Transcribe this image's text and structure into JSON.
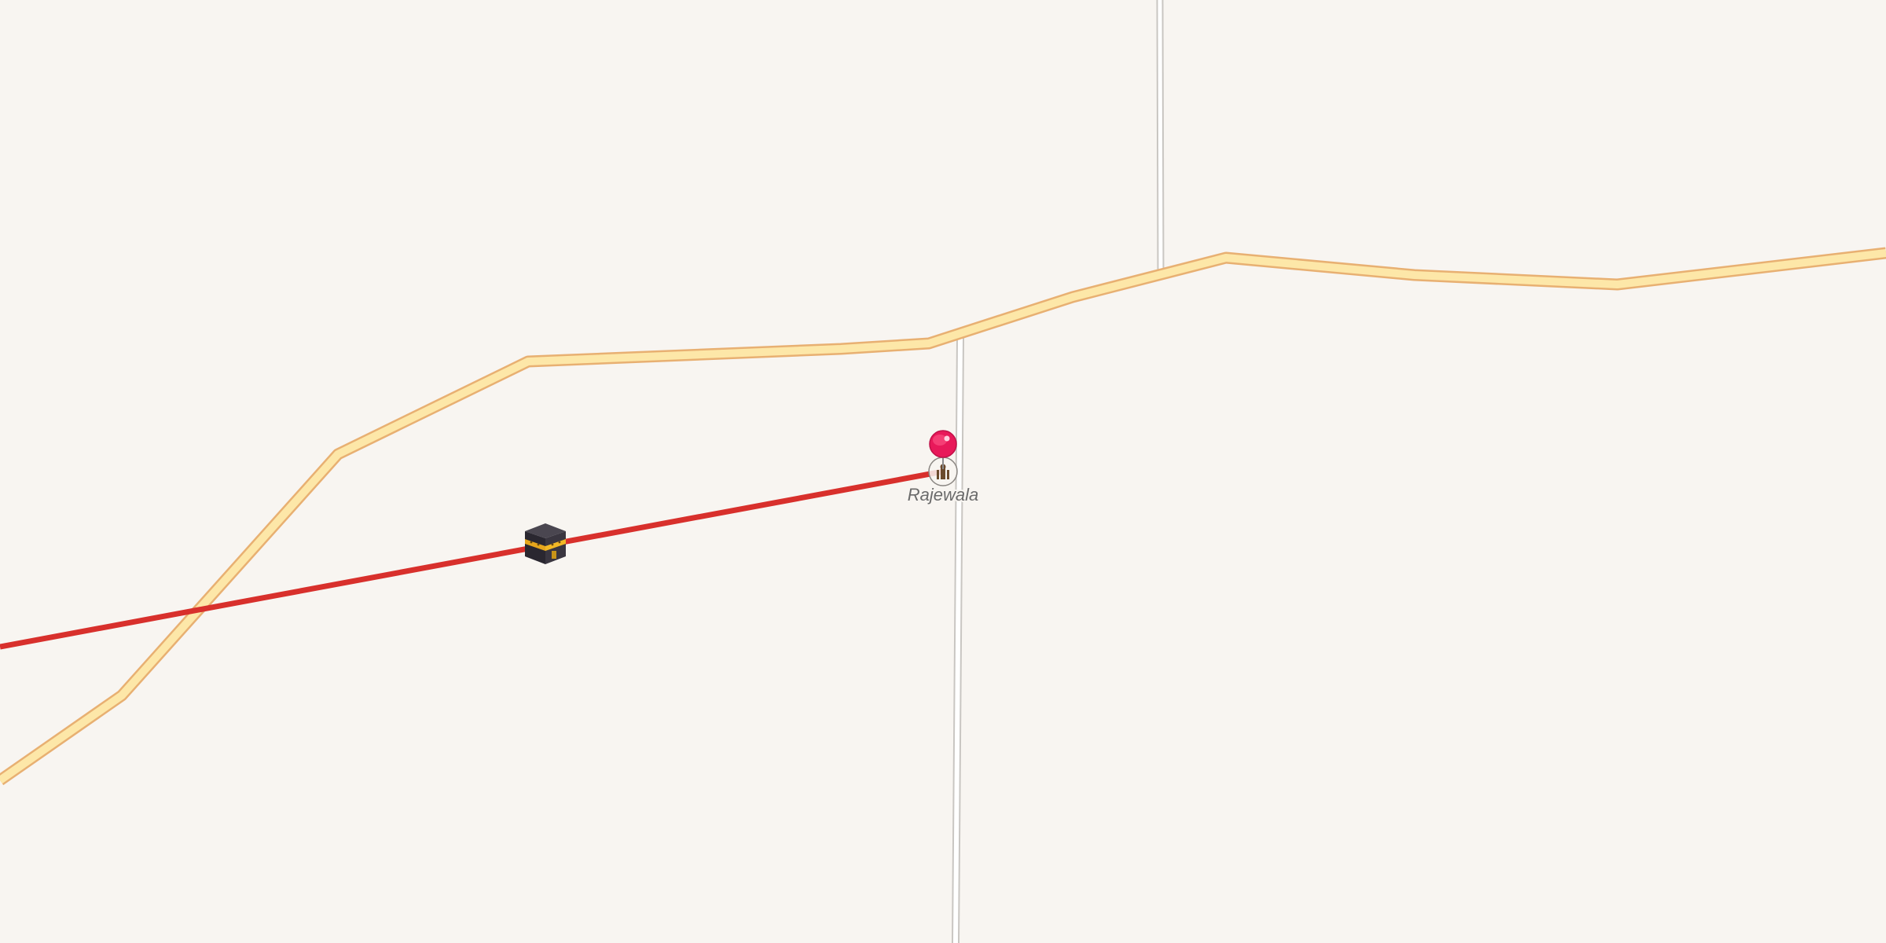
{
  "map": {
    "background_color": "#f8f5f1",
    "roads": {
      "primary": {
        "fill_color": "#fde7a8",
        "casing_color": "#e8b072"
      },
      "minor": {
        "fill_color": "#ffffff",
        "casing_color": "#c9c6c2"
      }
    },
    "route": {
      "color": "#d8302c"
    },
    "markers": {
      "pin": {
        "icon": "pin-icon",
        "color": "#e8195a"
      },
      "qibla": {
        "icon": "kaaba-icon"
      },
      "place": {
        "icon": "mosque-icon",
        "label": "Rajewala"
      }
    }
  }
}
